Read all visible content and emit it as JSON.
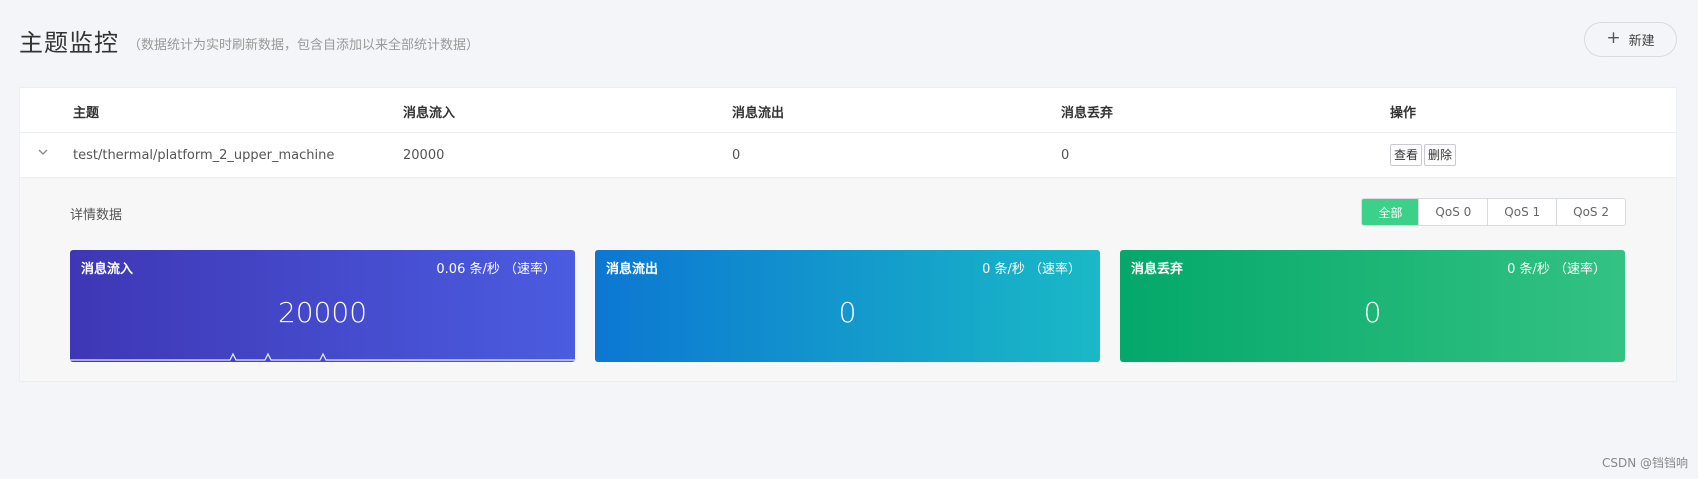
{
  "header": {
    "title": "主题监控",
    "subtitle": "（数据统计为实时刷新数据，包含自添加以来全部统计数据）",
    "new_button": "新建"
  },
  "table": {
    "columns": [
      "主题",
      "消息流入",
      "消息流出",
      "消息丢弃",
      "操作"
    ],
    "rows": [
      {
        "topic": "test/thermal/platform_2_upper_machine",
        "msg_in": "20000",
        "msg_out": "0",
        "msg_drop": "0",
        "actions": [
          "查看",
          "删除"
        ]
      }
    ]
  },
  "detail": {
    "title": "详情数据",
    "qos_tabs": [
      "全部",
      "QoS 0",
      "QoS 1",
      "QoS 2"
    ],
    "active_tab": "全部",
    "cards": [
      {
        "label": "消息流入",
        "rate": "0.06 条/秒 （速率）",
        "value": "20000",
        "color_start": "#3e37b5",
        "color_end": "#4b5ce0"
      },
      {
        "label": "消息流出",
        "rate": "0 条/秒 （速率）",
        "value": "0",
        "color_start": "#0c77d2",
        "color_end": "#1ab9c6"
      },
      {
        "label": "消息丢弃",
        "rate": "0 条/秒 （速率）",
        "value": "0",
        "color_start": "#04a86a",
        "color_end": "#33c283"
      }
    ]
  },
  "watermark": "CSDN @铛铛响"
}
